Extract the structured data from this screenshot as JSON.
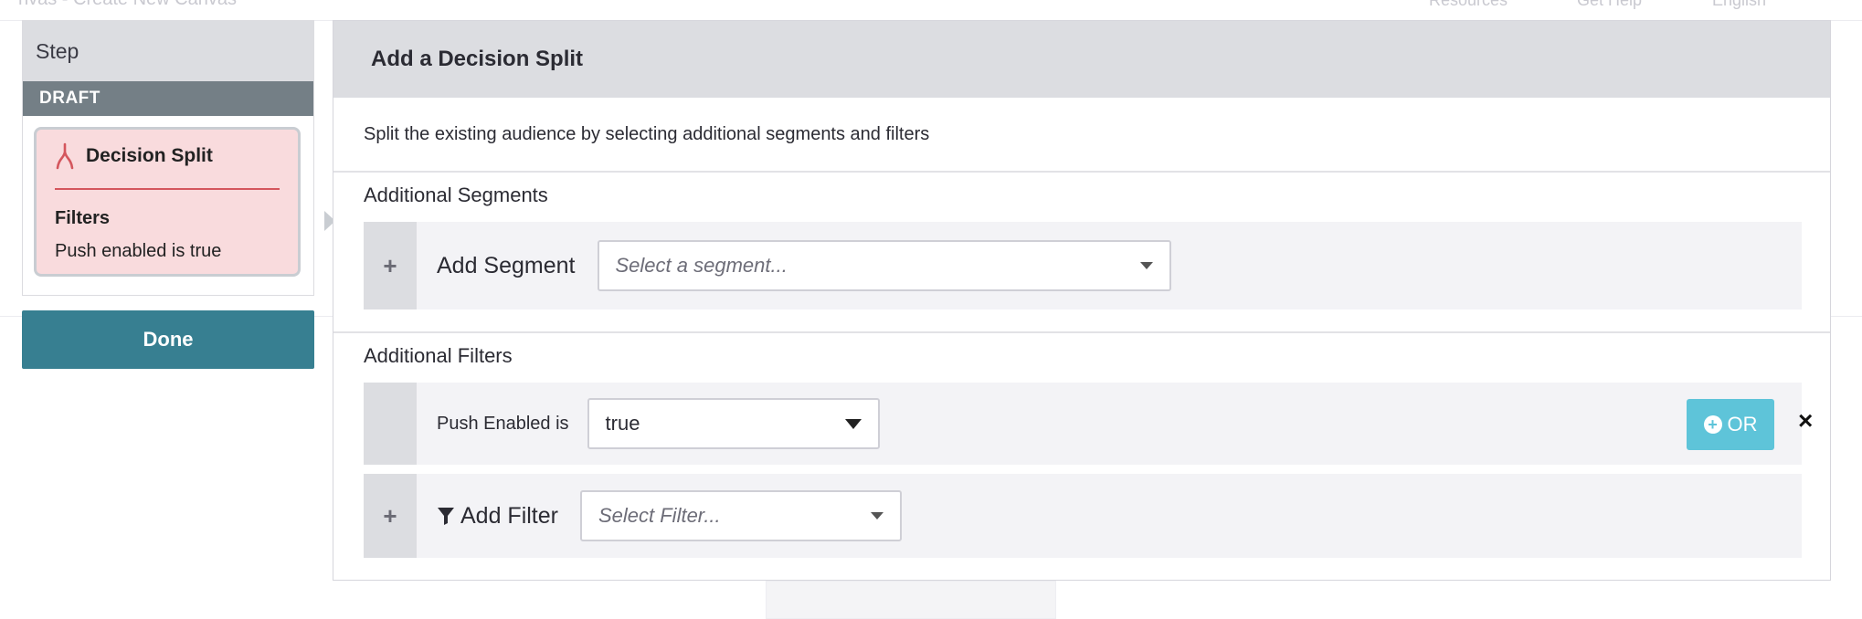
{
  "background": {
    "title": "nvas - Create New Canvas",
    "nav": [
      "Resources",
      "Get Help",
      "English"
    ]
  },
  "step_panel": {
    "header": "Step",
    "status": "DRAFT",
    "card": {
      "title": "Decision Split",
      "filters_label": "Filters",
      "filter_value": "Push enabled is true"
    },
    "done_label": "Done"
  },
  "modal": {
    "title": "Add a Decision Split",
    "description": "Split the existing audience by selecting additional segments and filters",
    "segments": {
      "title": "Additional Segments",
      "add_label": "Add Segment",
      "select_placeholder": "Select a segment..."
    },
    "filters": {
      "title": "Additional Filters",
      "existing": {
        "label": "Push Enabled is",
        "value": "true",
        "or_label": "OR",
        "remove_label": "×"
      },
      "add_label": "Add Filter",
      "select_placeholder": "Select Filter..."
    }
  },
  "colors": {
    "draft_bar": "#747f86",
    "done_button": "#377f91",
    "card_background": "#f9dbdd",
    "card_accent": "#d4565d",
    "or_button": "#5ec4d9"
  },
  "icons": {
    "gutter": "plus-icon",
    "decision": "decision-split-icon",
    "filter": "funnel-icon",
    "or": "plus-circle-icon",
    "remove": "close-icon"
  }
}
